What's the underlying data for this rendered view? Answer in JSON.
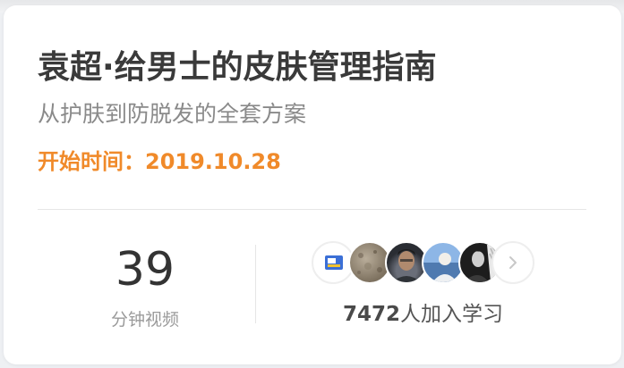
{
  "course": {
    "title": "袁超·给男士的皮肤管理指南",
    "subtitle": "从护肤到防脱发的全套方案",
    "start_label": "开始时间：",
    "start_date": "2019.10.28"
  },
  "stats": {
    "duration_value": "39",
    "duration_label": "分钟视频"
  },
  "learners": {
    "count": "7472",
    "count_suffix": "人加入学习",
    "avatars": [
      "app-logo-avatar",
      "texture-avatar",
      "man-portrait-avatar",
      "sky-portrait-avatar",
      "bw-portrait-avatar"
    ],
    "more_icon": "chevron-right-icon"
  },
  "colors": {
    "accent": "#f08a2a",
    "title": "#3a3a3a",
    "muted": "#8a8a8a"
  }
}
